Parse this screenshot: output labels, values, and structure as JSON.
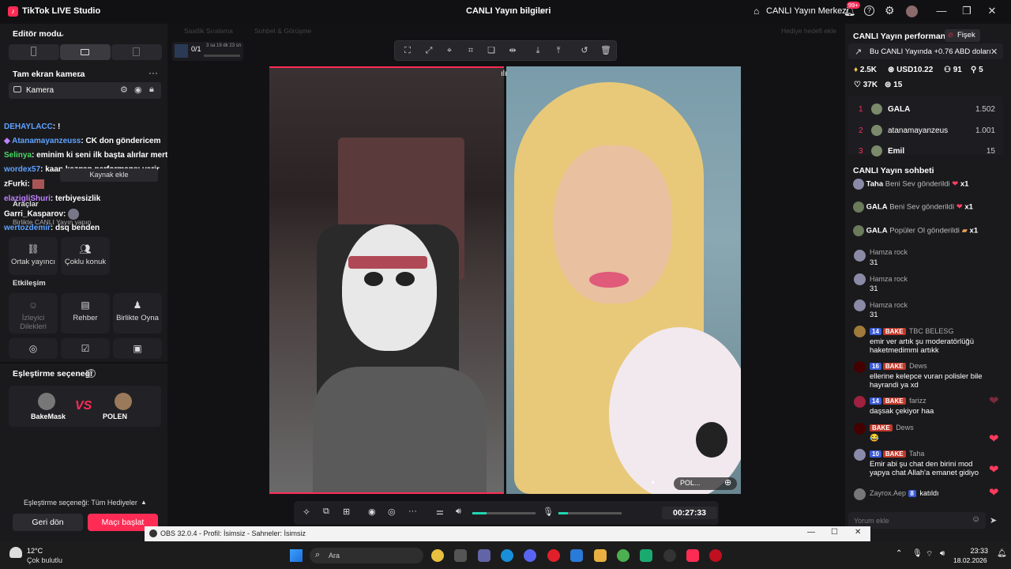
{
  "titlebar": {
    "app_title": "TikTok LIVE Studio",
    "live_info": "CANLI Yayın bilgileri",
    "live_center": "CANLI Yayın Merkezi",
    "notif_count": "99+"
  },
  "left": {
    "editor_mode": "Editör modu",
    "camera_section": "Tam ekran kamera",
    "camera_source": "Kamera",
    "add_source": "Kaynak ekle",
    "tools_title": "Araçlar",
    "tools_sub": "Birlikte CANLI Yayın yapın",
    "tools": [
      {
        "label": "Ortak yayıncı"
      },
      {
        "label": "Çoklu konuk"
      }
    ],
    "interaction_title": "Etkileşim",
    "interactions": [
      {
        "label": "İzleyici Dilekleri"
      },
      {
        "label": "Rehber"
      },
      {
        "label": "Birlikte Oyna"
      }
    ],
    "match_title": "Eşleştirme seçeneği",
    "player1": "BakeMask",
    "player2": "POLEN",
    "vs": "VS",
    "match_option": "Eşleştirme seçeneği: Tüm Hediyeler",
    "back_btn": "Geri dön",
    "start_btn": "Maçı başlat",
    "chat": [
      {
        "user": "DEHAYLACC",
        "text": ": !"
      },
      {
        "user": "Atanamayanzeuss",
        "text": ": CK don göndericem"
      },
      {
        "user": "Selinya",
        "text": ": eminim ki seni ilk başta alırlar mertcim"
      },
      {
        "user": "wordex57",
        "text": ": kaan kazgan performansı verir"
      },
      {
        "user": "zFurki",
        "text": ":"
      },
      {
        "user": "elazigliShuri",
        "text": ": terbiyesizlik"
      },
      {
        "user": "Garri_Kasparov",
        "text": ":"
      },
      {
        "user": "wertozdemir",
        "text": ": dsq benden"
      }
    ]
  },
  "center": {
    "ghost_labels": [
      "Saatlik Sıralama",
      "Sohbet & Görüşme",
      "Hediye hedefi ekle"
    ],
    "goal": "0/1",
    "goal_time": "3 sa 19 dk 23 sn",
    "guest_label": "POL...",
    "timer": "00:27:33"
  },
  "right": {
    "perf_title": "CANLI Yayın performansı",
    "fisek": "Fişek",
    "banner": "Bu CANLI Yayında +0.76 ABD doları",
    "stats": {
      "diamonds": "2.5K",
      "usd": "USD10.22",
      "viewers": "91",
      "new": "5",
      "likes": "37K",
      "shares": "15"
    },
    "ranking": [
      {
        "rank": "1",
        "name": "GALA",
        "score": "1.502"
      },
      {
        "rank": "2",
        "name": "atanamayanzeus",
        "score": "1.001"
      },
      {
        "rank": "3",
        "name": "Emil",
        "score": "15"
      }
    ],
    "chat_title": "CANLI Yayın sohbeti",
    "gifts": [
      {
        "user": "Taha",
        "text": "Beni Sev gönderildi",
        "count": "x1"
      },
      {
        "user": "GALA",
        "text": "Beni Sev gönderildi",
        "count": "x1"
      },
      {
        "user": "GALA",
        "text": "Popüler Ol gönderildi",
        "count": "x1"
      }
    ],
    "messages": [
      {
        "user": "Hamza rock",
        "text": "31"
      },
      {
        "user": "Hamza rock",
        "text": "31"
      },
      {
        "user": "Hamza rock",
        "text": "31"
      },
      {
        "level": "14",
        "badge": "BAKE",
        "user": "TBC BELESG",
        "text": "emir ver artık şu moderatörlüğü haketmedimmi artıkk"
      },
      {
        "level": "16",
        "badge": "BAKE",
        "user": "Dews",
        "text": "ellerine kelepce vuran polisler bile hayrandi ya xd"
      },
      {
        "level": "14",
        "badge": "BAKE",
        "user": "farizz",
        "text": "daşsak çekiyor haa"
      },
      {
        "badge": "BAKE",
        "user": "Dews",
        "text": "😂"
      },
      {
        "level": "10",
        "badge": "BAKE",
        "user": "Taha",
        "text": "Emir abi şu chat den birini mod yapya chat Allah'a emanet gidiyo"
      },
      {
        "user": "Zayrox.Aep",
        "level": "8",
        "text": "katıldı"
      }
    ],
    "comment_placeholder": "Yorum ekle"
  },
  "obs": {
    "title": "OBS 32.0.4 - Profil: İsimsiz - Sahneler: İsimsiz"
  },
  "taskbar": {
    "temp": "12°C",
    "weather": "Çok bulutlu",
    "search": "Ara",
    "time": "23:33",
    "date": "18.02.2026"
  },
  "colors": {
    "accent": "#fe2c55",
    "bg": "#111114",
    "panel": "#1a1a1d"
  }
}
